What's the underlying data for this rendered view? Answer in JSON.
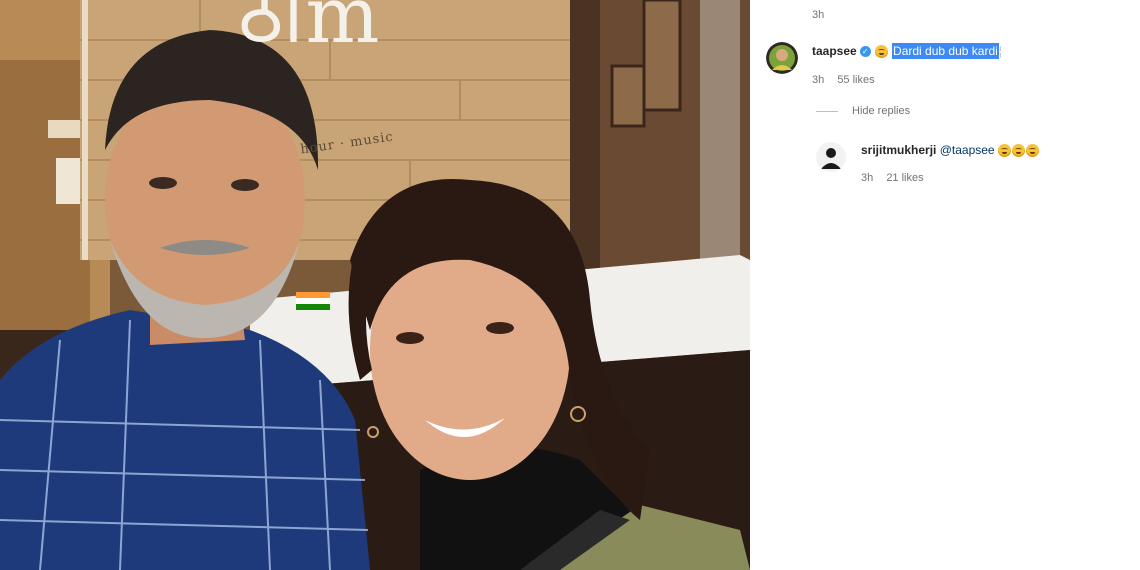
{
  "post": {
    "top_time": "3h"
  },
  "photo": {
    "sign_text": "ठोm",
    "sign_sub": "hour · music",
    "flag_colors": [
      "#ff9933",
      "#ffffff",
      "#138808"
    ]
  },
  "comments": [
    {
      "username": "taapsee",
      "verified": true,
      "emoji": "rolling-on-floor-laughing",
      "text": "Dardi dub dub kardi",
      "time": "3h",
      "likes": "55 likes",
      "hide_replies_label": "Hide replies",
      "replies": [
        {
          "username": "srijitmukherji",
          "mention": "@taapsee",
          "emojis": [
            "rolling-on-floor-laughing",
            "rolling-on-floor-laughing",
            "rolling-on-floor-laughing"
          ],
          "time": "3h",
          "likes": "21 likes"
        }
      ]
    }
  ],
  "colors": {
    "selection": "#3d8af7",
    "verified_badge": "#3897f0",
    "mention": "#00376b",
    "meta_text": "#737373"
  }
}
